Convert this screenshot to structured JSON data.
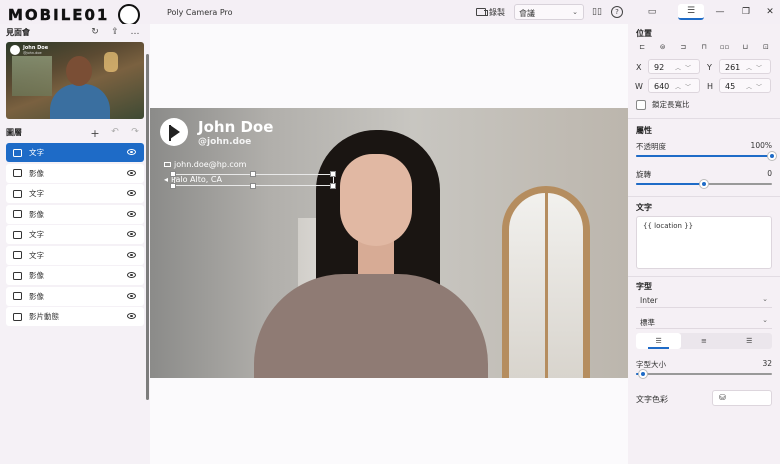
{
  "titlebar": {
    "logo_text": "MOBILE01",
    "app_title": "Poly Camera Pro",
    "record_label": "錄製",
    "meeting_select": "會議",
    "window_controls": [
      "minimize",
      "maximize",
      "close"
    ]
  },
  "left_panel": {
    "preview_label": "見面會",
    "thumbnail": {
      "name": "John Doe",
      "handle": "@john.doe"
    },
    "layers_label": "圖層",
    "layers": [
      {
        "label": "文字",
        "type": "text",
        "selected": true
      },
      {
        "label": "影像",
        "type": "image",
        "selected": false
      },
      {
        "label": "文字",
        "type": "text",
        "selected": false
      },
      {
        "label": "影像",
        "type": "image",
        "selected": false
      },
      {
        "label": "文字",
        "type": "text",
        "selected": false
      },
      {
        "label": "文字",
        "type": "text",
        "selected": false
      },
      {
        "label": "影像",
        "type": "image",
        "selected": false
      },
      {
        "label": "影像",
        "type": "image",
        "selected": false
      },
      {
        "label": "影片動態",
        "type": "video",
        "selected": false
      }
    ]
  },
  "overlay": {
    "name": "John Doe",
    "handle": "@john.doe",
    "email": "john.doe@hp.com",
    "location": "Palo Alto, CA"
  },
  "properties": {
    "position_label": "位置",
    "x_label": "X",
    "x_value": "92",
    "y_label": "Y",
    "y_value": "261",
    "w_label": "W",
    "w_value": "640",
    "h_label": "H",
    "h_value": "45",
    "lock_aspect_label": "鎖定長寬比",
    "attributes_label": "屬性",
    "opacity_label": "不透明度",
    "opacity_value": "100%",
    "opacity_fraction": 1.0,
    "rotation_label": "旋轉",
    "rotation_value": "0",
    "rotation_fraction": 0.5,
    "text_label": "文字",
    "text_value": "{{ location }}",
    "font_label": "字型",
    "font_family": "Inter",
    "font_style": "標準",
    "font_size_label": "字型大小",
    "font_size_value": "32",
    "font_size_fraction": 0.05,
    "text_color_label": "文字色彩"
  },
  "colors": {
    "accent": "#1e6bc7"
  }
}
